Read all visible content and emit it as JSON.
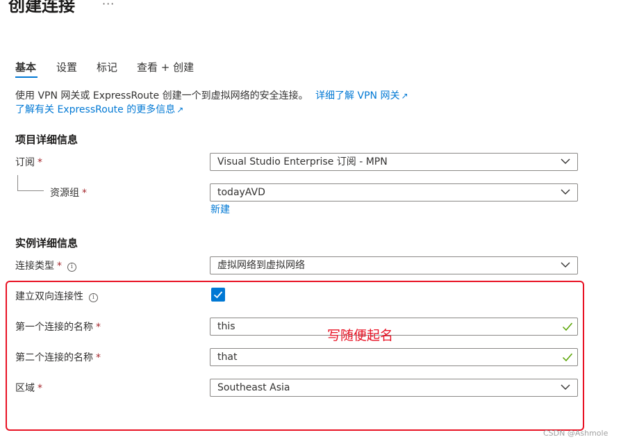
{
  "header": {
    "title": "创建连接",
    "more": "···"
  },
  "tabs": [
    {
      "label": "基本",
      "active": true
    },
    {
      "label": "设置",
      "active": false
    },
    {
      "label": "标记",
      "active": false
    },
    {
      "label": "查看 + 创建",
      "active": false
    }
  ],
  "description": {
    "text": "使用 VPN 网关或 ExpressRoute 创建一个到虚拟网络的安全连接。",
    "link1": "详细了解 VPN 网关",
    "link2": "了解有关 ExpressRoute 的更多信息"
  },
  "project": {
    "heading": "项目详细信息",
    "subscription_label": "订阅",
    "subscription_value": "Visual Studio Enterprise 订阅 - MPN",
    "resource_group_label": "资源组",
    "resource_group_value": "todayAVD",
    "new_link": "新建"
  },
  "instance": {
    "heading": "实例详细信息",
    "connection_type_label": "连接类型",
    "connection_type_value": "虚拟网络到虚拟网络",
    "bidirectional_label": "建立双向连接性",
    "bidirectional_checked": true,
    "first_name_label": "第一个连接的名称",
    "first_name_value": "this",
    "second_name_label": "第二个连接的名称",
    "second_name_value": "that",
    "region_label": "区域",
    "region_value": "Southeast Asia"
  },
  "required_mark": "*",
  "info_glyph": "i",
  "annotation": "写随便起名",
  "watermark": "CSDN @Ashmole",
  "colors": {
    "accent": "#0078d4",
    "required": "#a4262c",
    "annotation": "#e81123",
    "valid": "#57a300"
  }
}
